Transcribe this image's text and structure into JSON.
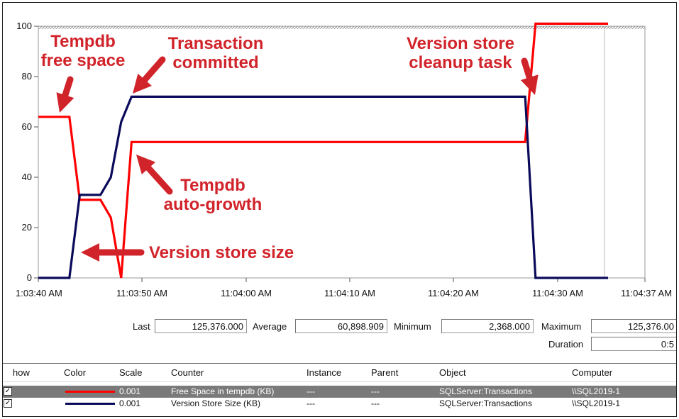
{
  "chart_data": {
    "type": "line",
    "x": [
      "11:03:40 AM",
      "11:03:41 AM",
      "11:03:42 AM",
      "11:03:43 AM",
      "11:03:44 AM",
      "11:03:45 AM",
      "11:03:46 AM",
      "11:03:47 AM",
      "11:03:48 AM",
      "11:03:49 AM",
      "11:03:50 AM",
      "11:03:51 AM",
      "11:04:27 AM",
      "11:04:28 AM",
      "11:04:29 AM",
      "11:04:35 AM"
    ],
    "x_seconds": [
      0,
      1,
      2,
      3,
      4,
      5,
      6,
      7,
      8,
      9,
      10,
      11,
      47,
      48,
      49,
      55
    ],
    "series": [
      {
        "name": "Free Space in tempdb (KB)",
        "color": "#ff0000",
        "values": [
          64,
          64,
          64,
          64,
          31,
          31,
          31,
          24,
          0,
          54,
          54,
          54,
          54,
          101,
          101,
          101
        ]
      },
      {
        "name": "Version Store Size (KB)",
        "color": "#0a0a5a",
        "values": [
          0,
          0,
          0,
          0,
          33,
          33,
          33,
          40,
          62,
          72,
          72,
          72,
          72,
          0,
          0,
          0
        ]
      }
    ],
    "ylim": [
      0,
      100
    ],
    "yticks": [
      0,
      20,
      40,
      60,
      80,
      100
    ],
    "xticks": [
      "1:03:40 AM",
      "11:03:50 AM",
      "11:04:00 AM",
      "11:04:10 AM",
      "11:04:20 AM",
      "11:04:30 AM",
      "11:04:37 AM"
    ],
    "annotations": [
      {
        "text": [
          "Tempdb",
          "free space"
        ]
      },
      {
        "text": [
          "Transaction",
          "committed"
        ]
      },
      {
        "text": [
          "Version store",
          "cleanup task"
        ]
      },
      {
        "text": [
          "Tempdb",
          "auto-growth"
        ]
      },
      {
        "text": [
          "Version store size"
        ]
      }
    ],
    "grid": false
  },
  "stats": {
    "last_label": "Last",
    "last_value": "125,376.000",
    "average_label": "Average",
    "average_value": "60,898.909",
    "minimum_label": "Minimum",
    "minimum_value": "2,368.000",
    "maximum_label": "Maximum",
    "maximum_value": "125,376.00",
    "duration_label": "Duration",
    "duration_value": "0:5"
  },
  "table": {
    "headers": {
      "show": "how",
      "color": "Color",
      "scale": "Scale",
      "counter": "Counter",
      "instance": "Instance",
      "parent": "Parent",
      "object": "Object",
      "computer": "Computer"
    },
    "rows": [
      {
        "show_mark": "✓",
        "line_color": "#ff0000",
        "scale": "0.001",
        "counter": "Free Space in tempdb (KB)",
        "instance": "---",
        "parent": "---",
        "object": "SQLServer:Transactions",
        "computer": "\\\\SQL2019-1"
      },
      {
        "show_mark": "✓",
        "line_color": "#0a0a5a",
        "scale": "0.001",
        "counter": "Version Store Size (KB)",
        "instance": "---",
        "parent": "---",
        "object": "SQLServer:Transactions",
        "computer": "\\\\SQL2019-1"
      }
    ]
  },
  "colors": {
    "annotation": "#d1232a",
    "selected_row": "#7a7a7a"
  }
}
